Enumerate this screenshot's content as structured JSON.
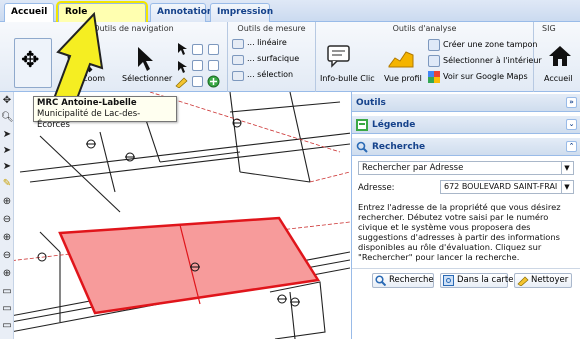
{
  "tabs": [
    {
      "label": "Accueil"
    },
    {
      "label": "Role d'évaluation"
    },
    {
      "label": "Annotation"
    },
    {
      "label": "Impression"
    }
  ],
  "ribbon": {
    "nav_title": "Outils de navigation",
    "measure_title": "Outils de mesure",
    "analysis_title": "Outils d'analyse",
    "sig_title": "SIG",
    "zoom_label": "Zoom",
    "select_label": "Sélectionner",
    "linear_label": "... linéaire",
    "surface_label": "... surfacique",
    "selection_label": "... sélection",
    "infobulle_label": "Info-bulle Clic",
    "profile_label": "Vue profil",
    "create_zone_label": "Créer une zone tampon",
    "select_inside_label": "Sélectionner à l'intérieur",
    "google_maps_label": "Voir sur Google Maps",
    "home_label": "Accueil"
  },
  "tooltip": {
    "title": "MRC Antoine-Labelle",
    "subtitle": "Municipalité de Lac-des-Écorces"
  },
  "panel": {
    "outils_title": "Outils",
    "legende_title": "Légende",
    "recherche_title": "Recherche",
    "search_type_value": "Rechercher par Adresse",
    "address_label": "Adresse:",
    "address_value": "672 BOULEVARD SAINT-FRAI",
    "help_text": "Entrez l'adresse de la propriété que vous désirez rechercher. Débutez votre saisi par le numéro civique et le système vous proposera des suggestions d'adresses à partir des informations disponibles au rôle d'évaluation. Cliquez sur \"Rechercher\" pour lancer la recherche.",
    "btn_search": "Recherche",
    "btn_in_map": "Dans la carte",
    "btn_clear": "Nettoyer"
  },
  "colors": {
    "parcel_fill": "#f79b9b",
    "parcel_stroke": "#e0151b",
    "highlight": "#f2e600",
    "arrow_fill": "#f5ee22",
    "header_text": "#15428b"
  }
}
